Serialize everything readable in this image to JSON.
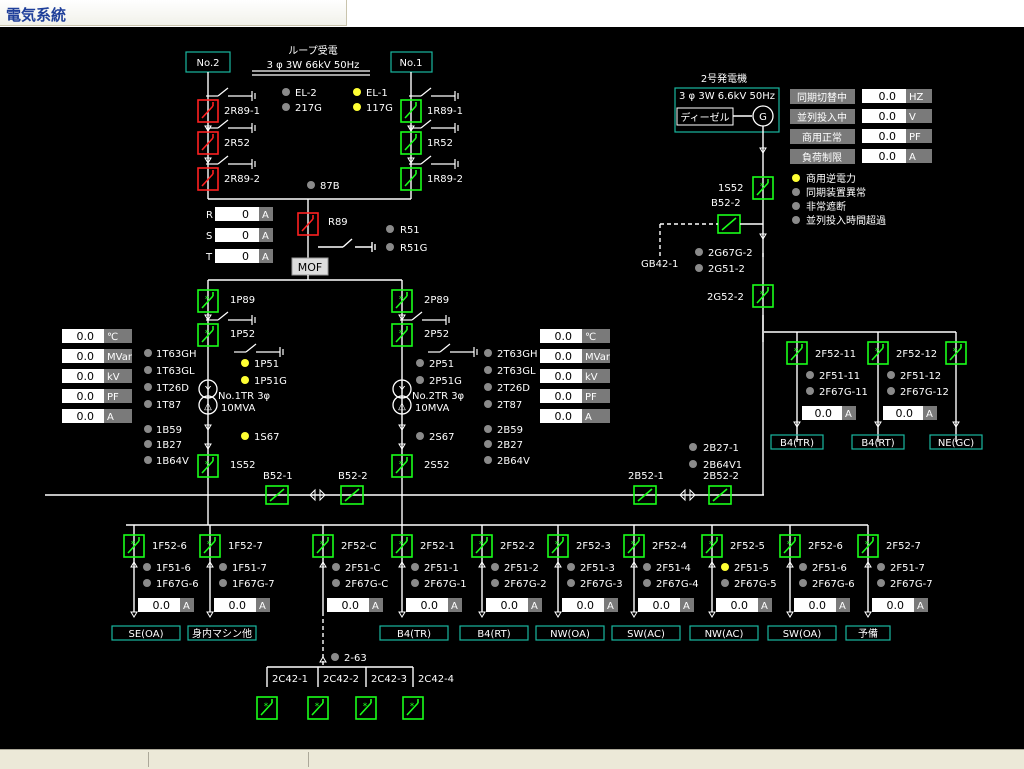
{
  "window": {
    "title": "電気系統"
  },
  "colors": {
    "closed": "#19ff19",
    "open_red": "#ff2020",
    "line": "#ffffff",
    "box": "#19b7a0",
    "lamp_on": "#ffff33",
    "lamp_off": "#8a8a8a",
    "unit_bg": "#7a7a7a"
  },
  "header": {
    "line1": "ループ受電",
    "line2": "3 φ 3W 66kV 50Hz"
  },
  "incoming": {
    "no2": "No.2",
    "no1": "No.1"
  },
  "left_stack": {
    "b1": "2R89-1",
    "b2": "2R52",
    "b3": "2R89-2"
  },
  "right_stack": {
    "b1": "1R89-1",
    "b2": "1R52",
    "b3": "1R89-2"
  },
  "top_lamps": {
    "el2": "EL-2",
    "g217": "217G",
    "el1": "EL-1",
    "g117": "117G",
    "l87b": "87B",
    "r51": "R51",
    "r51g": "R51G"
  },
  "r89": {
    "label": "R89",
    "mof": "MOF"
  },
  "rst": [
    {
      "phase": "R",
      "value": "0",
      "unit": "A"
    },
    {
      "phase": "S",
      "value": "0",
      "unit": "A"
    },
    {
      "phase": "T",
      "value": "0",
      "unit": "A"
    }
  ],
  "feeder1": {
    "p89": "1P89",
    "p52": "1P52",
    "s52": "1S52",
    "s67": "1S67",
    "lamps": [
      "1T63GH",
      "1T63GL",
      "1T26D",
      "1T87",
      "1B59",
      "1B27",
      "1B64V"
    ],
    "p51": "1P51",
    "p51g": "1P51G",
    "tr": "No.1TR 3φ",
    "tr_cap": "10MVA",
    "meters": [
      {
        "value": "0.0",
        "unit": "℃"
      },
      {
        "value": "0.0",
        "unit": "MVar"
      },
      {
        "value": "0.0",
        "unit": "kV"
      },
      {
        "value": "0.0",
        "unit": "PF"
      },
      {
        "value": "0.0",
        "unit": "A"
      }
    ]
  },
  "feeder2": {
    "p89": "2P89",
    "p52": "2P52",
    "s52": "2S52",
    "s67": "2S67",
    "lamps": [
      "2T63GH",
      "2T63GL",
      "2T26D",
      "2T87",
      "2B59",
      "2B27",
      "2B64V"
    ],
    "p51": "2P51",
    "p51g": "2P51G",
    "tr": "No.2TR 3φ",
    "tr_cap": "10MVA",
    "meters": [
      {
        "value": "0.0",
        "unit": "℃"
      },
      {
        "value": "0.0",
        "unit": "MVar"
      },
      {
        "value": "0.0",
        "unit": "kV"
      },
      {
        "value": "0.0",
        "unit": "PF"
      },
      {
        "value": "0.0",
        "unit": "A"
      }
    ]
  },
  "generator": {
    "title": "2号発電機",
    "spec": "3 φ 3W 6.6kV 50Hz",
    "engine": "ディーゼル",
    "symbol": "G",
    "s52": "1S52",
    "b52_2": "B52-2",
    "gb42": "GB42-1",
    "g67": "2G67G-2",
    "g51": "2G51-2",
    "g52": "2G52-2",
    "status": [
      {
        "label": "同期切替中",
        "value": "0.0",
        "unit": "HZ"
      },
      {
        "label": "並列投入中",
        "value": "0.0",
        "unit": "V"
      },
      {
        "label": "商用正常",
        "value": "0.0",
        "unit": "PF"
      },
      {
        "label": "負荷制限",
        "value": "0.0",
        "unit": "A"
      }
    ],
    "alarms": [
      "商用逆電力",
      "同期装置異常",
      "非常遮断",
      "並列投入時間超過"
    ]
  },
  "gen_feeders": [
    {
      "id": "2F52-11",
      "l1": "2F51-11",
      "l2": "2F67G-11",
      "value": "0.0",
      "unit": "A",
      "dest": "B4(TR)"
    },
    {
      "id": "2F52-12",
      "l1": "2F51-12",
      "l2": "2F67G-12",
      "value": "0.0",
      "unit": "A",
      "dest": "B4(RT)"
    },
    {
      "dest": "NE(GC)"
    }
  ],
  "bus": {
    "b52_1": "B52-1",
    "b52_2": "B52-2",
    "b2_1": "2B52-1",
    "b2_2": "2B52-2",
    "b27": "2B27-1",
    "b64": "2B64V1"
  },
  "bottom_feeders": [
    {
      "id": "1F52-6",
      "l1": "1F51-6",
      "l2": "1F67G-6",
      "value": "0.0",
      "unit": "A",
      "dest": "SE(OA)"
    },
    {
      "id": "1F52-7",
      "l1": "1F51-7",
      "l2": "1F67G-7",
      "value": "0.0",
      "unit": "A",
      "dest": "身内マシン他"
    },
    {
      "id": "2F52-C",
      "l1": "2F51-C",
      "l2": "2F67G-C",
      "value": "0.0",
      "unit": "A",
      "dest": ""
    },
    {
      "id": "2F52-1",
      "l1": "2F51-1",
      "l2": "2F67G-1",
      "value": "0.0",
      "unit": "A",
      "dest": "B4(TR)"
    },
    {
      "id": "2F52-2",
      "l1": "2F51-2",
      "l2": "2F67G-2",
      "value": "0.0",
      "unit": "A",
      "dest": "B4(RT)"
    },
    {
      "id": "2F52-3",
      "l1": "2F51-3",
      "l2": "2F67G-3",
      "value": "0.0",
      "unit": "A",
      "dest": "NW(OA)"
    },
    {
      "id": "2F52-4",
      "l1": "2F51-4",
      "l2": "2F67G-4",
      "value": "0.0",
      "unit": "A",
      "dest": "SW(AC)"
    },
    {
      "id": "2F52-5",
      "l1": "2F51-5",
      "l2": "2F67G-5",
      "value": "0.0",
      "unit": "A",
      "dest": "NW(AC)"
    },
    {
      "id": "2F52-6",
      "l1": "2F51-6",
      "l2": "2F67G-6",
      "value": "0.0",
      "unit": "A",
      "dest": "SW(OA)"
    },
    {
      "id": "2F52-7",
      "l1": "2F51-7",
      "l2": "2F67G-7",
      "value": "0.0",
      "unit": "A",
      "dest": "予備"
    }
  ],
  "capacitor": {
    "c263": "2-63",
    "items": [
      "2C42-1",
      "2C42-2",
      "2C42-3",
      "2C42-4"
    ]
  }
}
